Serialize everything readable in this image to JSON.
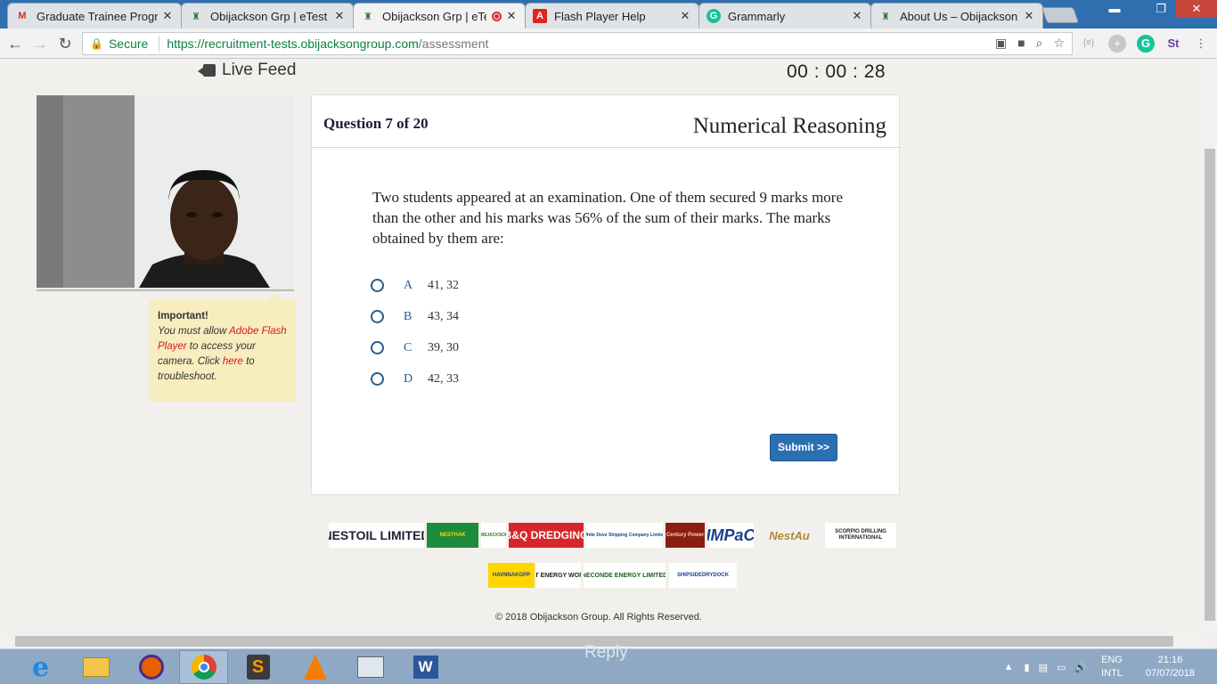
{
  "browser": {
    "tabs": [
      {
        "label": "Graduate Trainee Program",
        "icon": "gmail-icon"
      },
      {
        "label": "Obijackson Grp | eTest Po",
        "icon": "obijackson-icon"
      },
      {
        "label": "Obijackson Grp | eTes",
        "icon": "obijackson-icon",
        "active": true
      },
      {
        "label": "Flash Player Help",
        "icon": "adobe-icon"
      },
      {
        "label": "Grammarly",
        "icon": "grammarly-icon"
      },
      {
        "label": "About Us – Obijackson Fo",
        "icon": "obijackson-icon"
      }
    ],
    "secure_label": "Secure",
    "url_host": "https://recruitment-tests.obijacksongroup.com",
    "url_path": "/assessment"
  },
  "page": {
    "live_feed_label": "Live Feed",
    "timer": "00 : 00 : 28",
    "notice": {
      "title": "Important!",
      "part1": "You must allow ",
      "link1": "Adobe Flash Player",
      "part2": " to access your camera. Click ",
      "link2": "here",
      "part3": " to troubleshoot."
    },
    "question": {
      "number_label": "Question 7 of 20",
      "category": "Numerical Reasoning",
      "text": "Two students appeared at an examination. One of them secured 9 marks more than the other and his marks was 56% of the sum of their marks. The marks obtained by them are:",
      "options": [
        {
          "letter": "A",
          "value": "41, 32"
        },
        {
          "letter": "B",
          "value": "43, 34"
        },
        {
          "letter": "C",
          "value": "39, 30"
        },
        {
          "letter": "D",
          "value": "42, 33"
        }
      ],
      "submit_label": "Submit >>"
    },
    "sponsors": [
      "NESTOIL LIMITED",
      "NESTHAK",
      "OBIJACKSON",
      "B&Q DREDGING",
      "White Dove Shipping Company Limited",
      "Century Power",
      "IMPaC",
      "NestAu",
      "SCORPIO DRILLING INTERNATIONAL",
      "HAVNNAKOPP",
      "EWT ENERGY WORKS",
      "NECONDE ENERGY LIMITED",
      "SHIPSIDEDRYDOCK"
    ],
    "copyright": "© 2018 Obijackson Group. All Rights Reserved."
  },
  "taskbar": {
    "ghost_text": "Reply",
    "lang": "ENG",
    "layout": "INTL",
    "time": "21:16",
    "date": "07/07/2018"
  },
  "colors": {
    "accent": "#2b6fb3",
    "notice_bg": "#f7edbf",
    "link_red": "#d21a1a",
    "secure_green": "#0b8043"
  }
}
